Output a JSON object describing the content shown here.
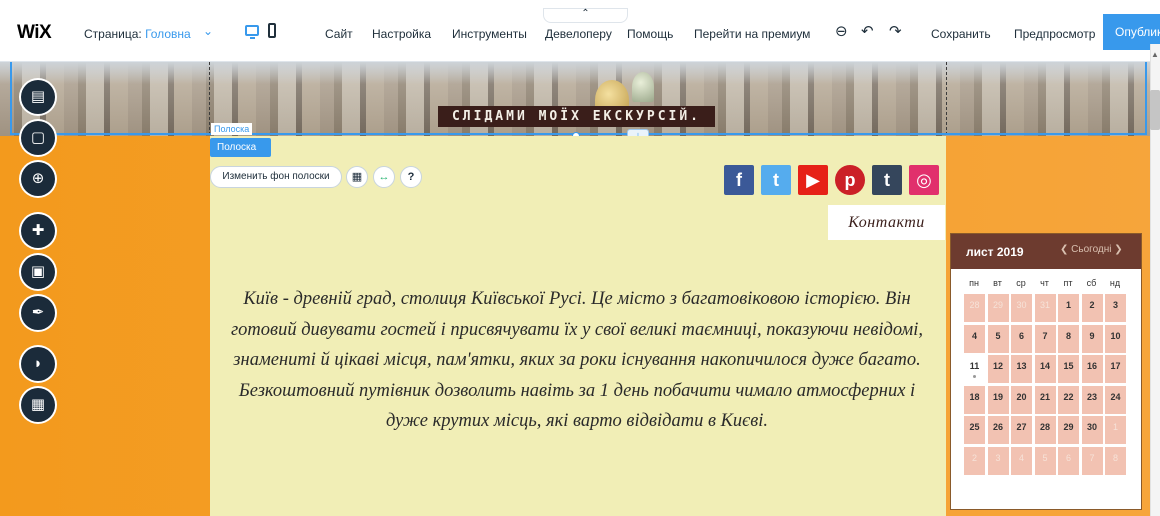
{
  "topbar": {
    "logo": "WiX",
    "page_label": "Страница:",
    "page_value": "Головна",
    "menu": [
      "Сайт",
      "Настройка",
      "Инструменты",
      "Девелоперу",
      "Помощь",
      "Перейти на премиум"
    ],
    "save": "Сохранить",
    "preview": "Предпросмотр",
    "publish": "Опубликовать"
  },
  "banner": {
    "title": "СЛІДАМИ МОЇХ ЕКСКУРСІЙ.",
    "strip_tag": "Полоска"
  },
  "editor": {
    "strip_button": "Полоска",
    "change_bg": "Изменить фон полоски"
  },
  "social": [
    {
      "name": "facebook",
      "glyph": "f",
      "color": "#3b5998"
    },
    {
      "name": "twitter",
      "glyph": "t",
      "color": "#55acee"
    },
    {
      "name": "youtube",
      "glyph": "▶",
      "color": "#e62117"
    },
    {
      "name": "pinterest",
      "glyph": "p",
      "color": "#cb2027"
    },
    {
      "name": "tumblr",
      "glyph": "t",
      "color": "#35465c"
    },
    {
      "name": "instagram",
      "glyph": "◎",
      "color": "#e1306c"
    }
  ],
  "contact_label": "Контакти",
  "paragraph": "Київ - древній град, столиця Київської Русі. Це місто з багатовіковою історією. Він готовий дивувати гостей і присвячувати їх у свої великі таємниці, показуючи невідомі, знамениті й цікаві місця, пам'ятки, яких за роки існування накопичилося дуже багато.  Безкоштовний путівник дозволить навіть за 1 день побачити чимало атмосферних і дуже крутих місць, які варто відвідати в Києві.",
  "calendar": {
    "month": "лист 2019",
    "today_label": "Сьогодні",
    "dow": [
      "пн",
      "вт",
      "ср",
      "чт",
      "пт",
      "сб",
      "нд"
    ],
    "weeks": [
      [
        "28",
        "29",
        "30",
        "31",
        "1",
        "2",
        "3"
      ],
      [
        "4",
        "5",
        "6",
        "7",
        "8",
        "9",
        "10"
      ],
      [
        "11",
        "12",
        "13",
        "14",
        "15",
        "16",
        "17"
      ],
      [
        "18",
        "19",
        "20",
        "21",
        "22",
        "23",
        "24"
      ],
      [
        "25",
        "26",
        "27",
        "28",
        "29",
        "30",
        "1"
      ],
      [
        "2",
        "3",
        "4",
        "5",
        "6",
        "7",
        "8"
      ]
    ],
    "dim_cells": [
      "0-0",
      "0-1",
      "0-2",
      "0-3",
      "4-6",
      "5-0",
      "5-1",
      "5-2",
      "5-3",
      "5-4",
      "5-5",
      "5-6"
    ],
    "today": "2-0"
  },
  "rail": [
    "pages-icon",
    "background-icon",
    "add-icon",
    "apps-icon",
    "media-icon",
    "pen-icon",
    "chat-icon",
    "calendar-icon"
  ]
}
